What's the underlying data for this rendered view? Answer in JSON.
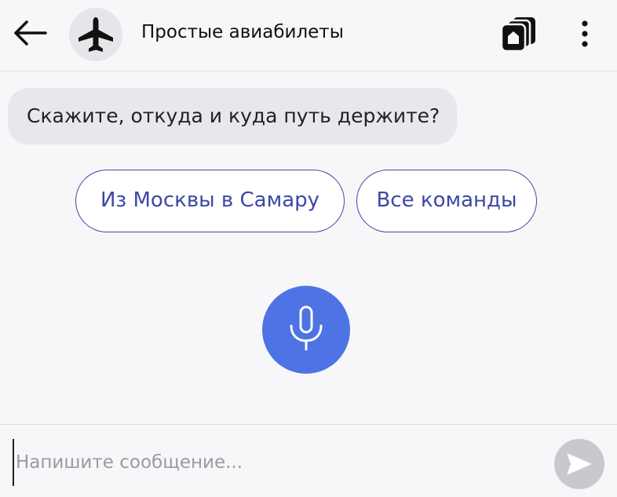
{
  "header": {
    "title": "Простые авиабилеты",
    "back_icon": "arrow-left-icon",
    "avatar_icon": "airplane-icon",
    "cards_icon": "cards-stack-icon",
    "menu_icon": "more-vertical-icon"
  },
  "chat": {
    "assistant_message": "Скажите, откуда и куда путь держите?"
  },
  "suggestions": [
    {
      "label": "Из Москвы в Самару"
    },
    {
      "label": "Все команды"
    }
  ],
  "voice": {
    "icon": "microphone-icon"
  },
  "composer": {
    "placeholder": "Напишите сообщение...",
    "value": "",
    "send_icon": "send-icon"
  },
  "colors": {
    "accent": "#3d48a5",
    "mic_button": "#4d73e5",
    "bubble_background": "#e8e8ec",
    "send_button": "#c9c9cd"
  }
}
